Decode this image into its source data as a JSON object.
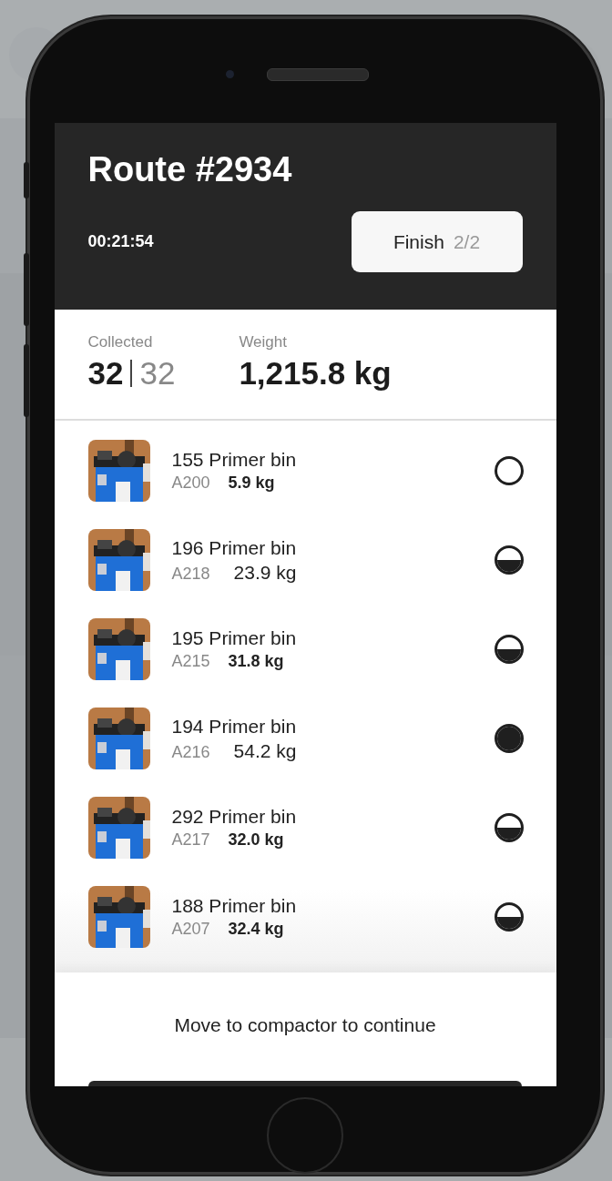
{
  "header": {
    "title": "Route #2934",
    "timer": "00:21:54",
    "finish_button": {
      "label": "Finish",
      "count": "2/2"
    }
  },
  "stats": {
    "collected": {
      "label": "Collected",
      "value": "32",
      "total": "32"
    },
    "weight": {
      "label": "Weight",
      "value": "1,215.8 kg"
    }
  },
  "bins": [
    {
      "name": "155 Primer bin",
      "code": "A200",
      "weight": "5.9 kg",
      "bold": true,
      "kind": "empty"
    },
    {
      "name": "196 Primer bin",
      "code": "A218",
      "weight": "23.9 kg",
      "bold": false,
      "kind": "half"
    },
    {
      "name": "195 Primer bin",
      "code": "A215",
      "weight": "31.8 kg",
      "bold": true,
      "kind": "half"
    },
    {
      "name": "194 Primer bin",
      "code": "A216",
      "weight": "54.2 kg",
      "bold": false,
      "kind": "full"
    },
    {
      "name": "292 Primer bin",
      "code": "A217",
      "weight": "32.0 kg",
      "bold": true,
      "kind": "half"
    },
    {
      "name": "188 Primer bin",
      "code": "A207",
      "weight": "32.4 kg",
      "bold": true,
      "kind": "half"
    }
  ],
  "footer": {
    "message": "Move to compactor to continue"
  }
}
